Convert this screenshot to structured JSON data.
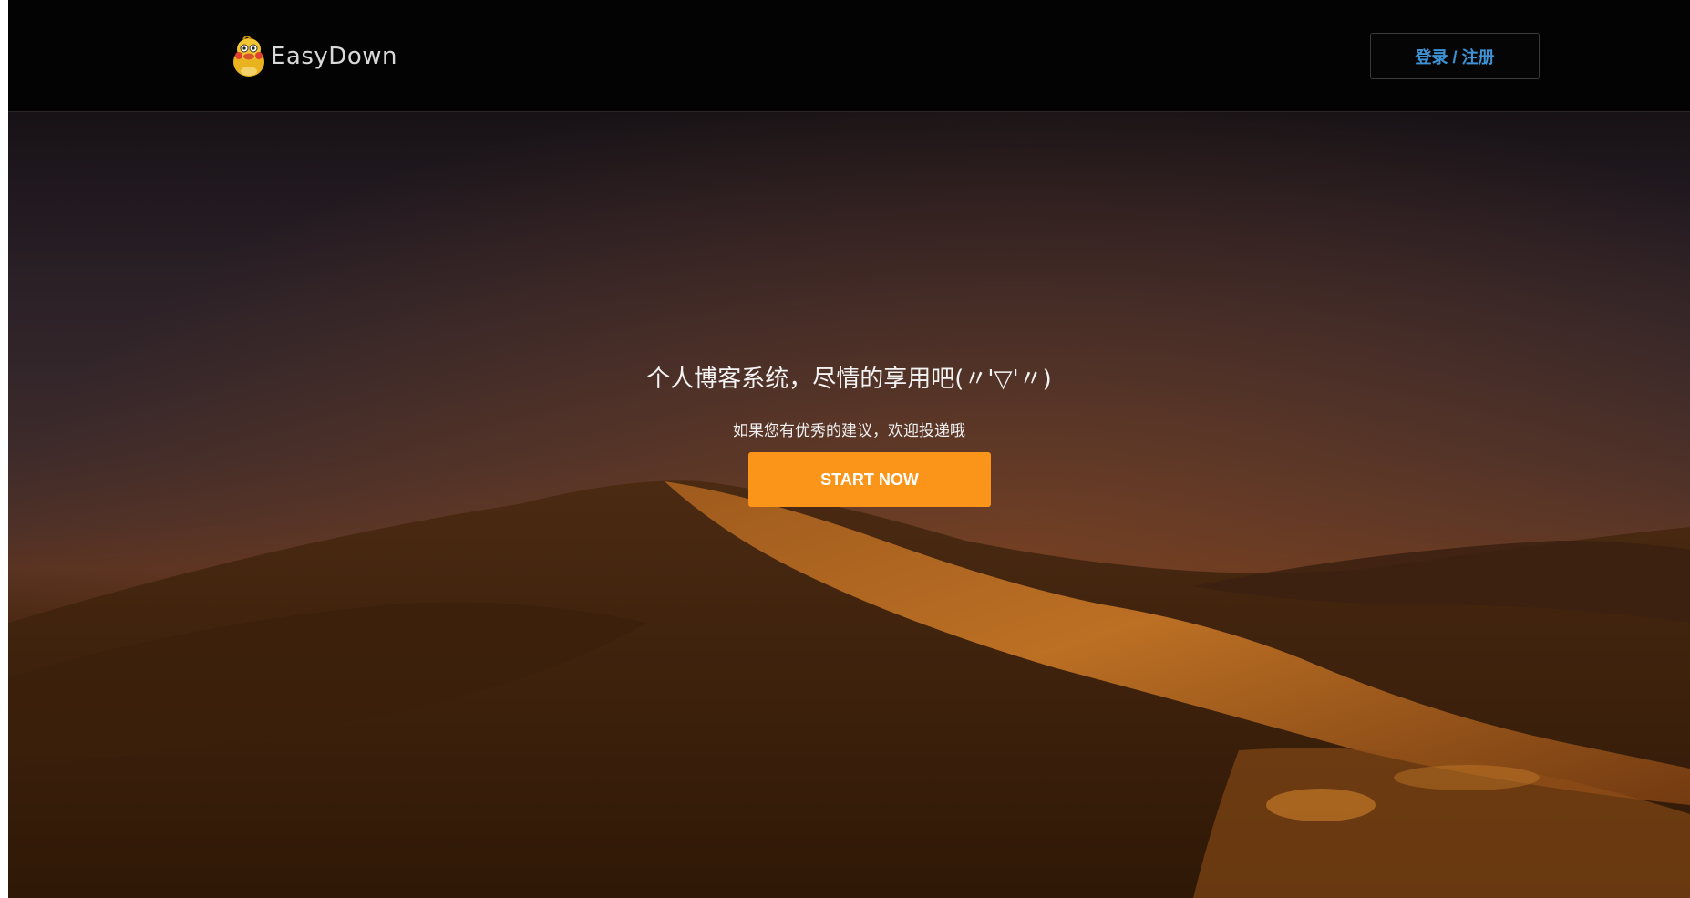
{
  "header": {
    "logo_text": "EasyDown",
    "login_label": "登录 / 注册"
  },
  "hero": {
    "headline": "个人博客系统，尽情的享用吧(〃'▽'〃)",
    "subline": "如果您有优秀的建议，欢迎投递哦",
    "cta_label": "START NOW"
  },
  "colors": {
    "cta_background": "#fb9519",
    "login_text": "#3d93d6",
    "topbar_background": "#030303"
  }
}
